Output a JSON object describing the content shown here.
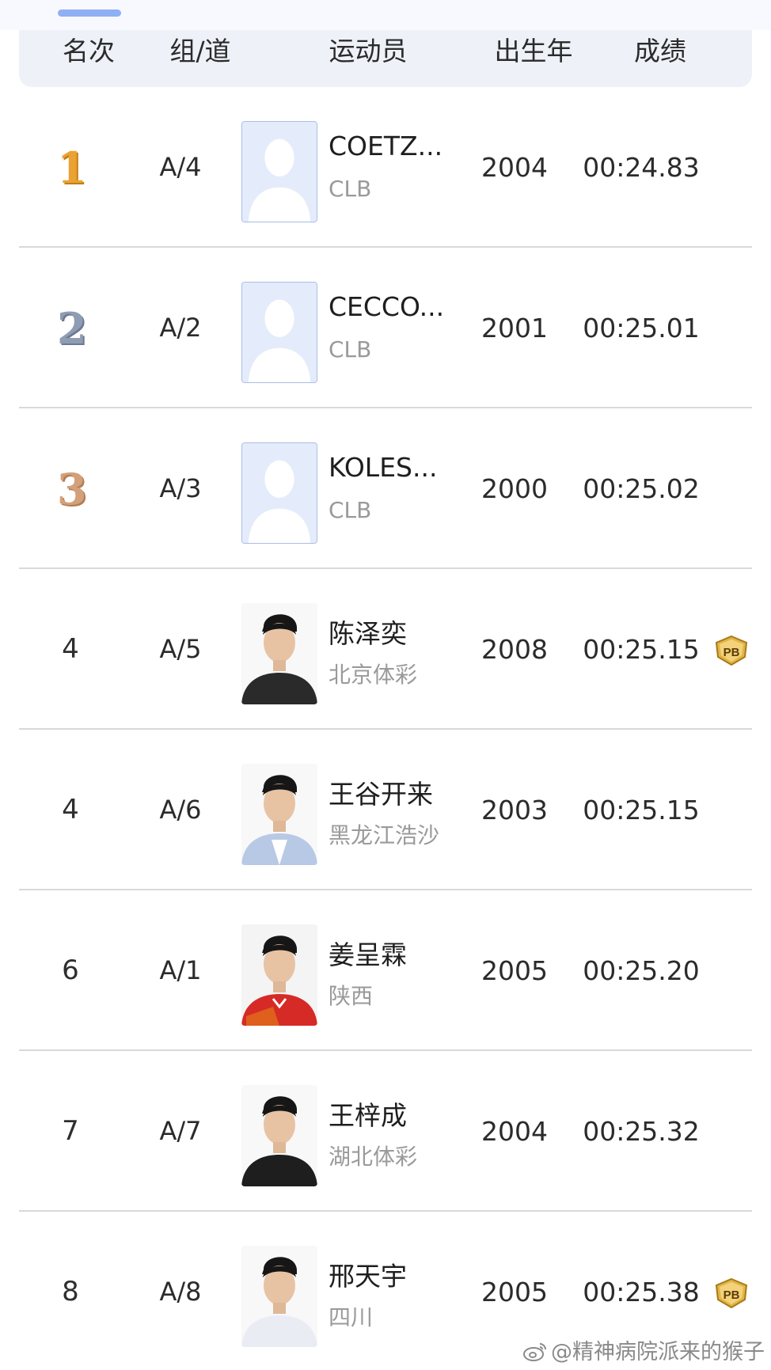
{
  "header": {
    "rank": "名次",
    "lane": "组/道",
    "athlete": "运动员",
    "year": "出生年",
    "result": "成绩"
  },
  "rows": [
    {
      "rank": "1",
      "medal": "gold",
      "lane": "A/4",
      "name": "COETZ...",
      "team": "CLB",
      "year": "2004",
      "result": "00:24.83",
      "pb": false,
      "photo": "placeholder"
    },
    {
      "rank": "2",
      "medal": "silver",
      "lane": "A/2",
      "name": "CECCO...",
      "team": "CLB",
      "year": "2001",
      "result": "00:25.01",
      "pb": false,
      "photo": "placeholder"
    },
    {
      "rank": "3",
      "medal": "bronze",
      "lane": "A/3",
      "name": "KOLES...",
      "team": "CLB",
      "year": "2000",
      "result": "00:25.02",
      "pb": false,
      "photo": "placeholder"
    },
    {
      "rank": "4",
      "medal": "",
      "lane": "A/5",
      "name": "陈泽奕",
      "team": "北京体彩",
      "year": "2008",
      "result": "00:25.15",
      "pb": true,
      "pb_label": "PB",
      "photo": "dark-jacket"
    },
    {
      "rank": "4",
      "medal": "",
      "lane": "A/6",
      "name": "王谷开来",
      "team": "黑龙江浩沙",
      "year": "2003",
      "result": "00:25.15",
      "pb": false,
      "photo": "light-blue-suit"
    },
    {
      "rank": "6",
      "medal": "",
      "lane": "A/1",
      "name": "姜呈霖",
      "team": "陕西",
      "year": "2005",
      "result": "00:25.20",
      "pb": false,
      "photo": "red-jacket"
    },
    {
      "rank": "7",
      "medal": "",
      "lane": "A/7",
      "name": "王梓成",
      "team": "湖北体彩",
      "year": "2004",
      "result": "00:25.32",
      "pb": false,
      "photo": "black-shirt"
    },
    {
      "rank": "8",
      "medal": "",
      "lane": "A/8",
      "name": "邢天宇",
      "team": "四川",
      "year": "2005",
      "result": "00:25.38",
      "pb": true,
      "pb_label": "PB",
      "photo": "white-shirt"
    }
  ],
  "colors": {
    "gold": "#e9a233",
    "silver": "#8e9db3",
    "bronze": "#d4a07a",
    "pb_badge": "#d9a93a",
    "divider": "#d9d9d9",
    "header_bg": "#eef1f7"
  },
  "watermark": "@精神病院派来的猴子",
  "icons": {
    "weibo": "weibo-icon",
    "placeholder": "person-silhouette-icon",
    "pb": "pb-shield-icon"
  }
}
